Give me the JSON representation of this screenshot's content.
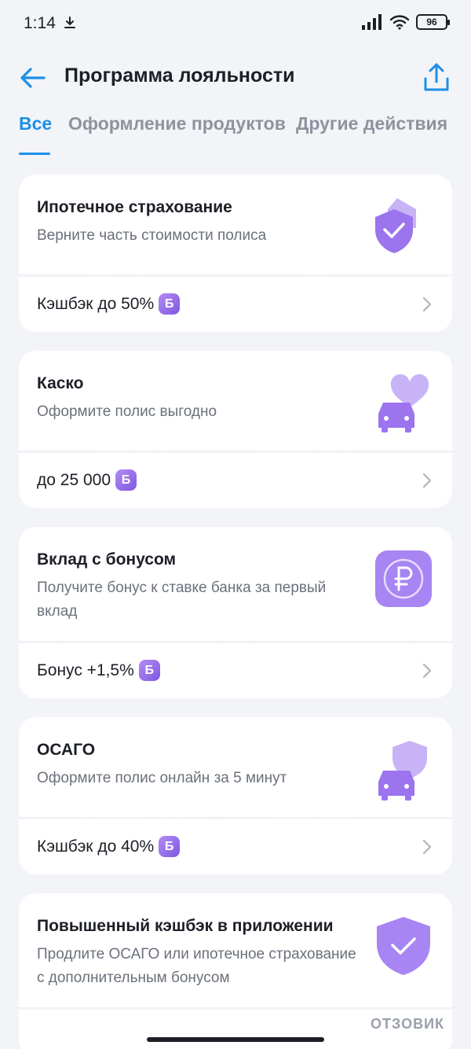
{
  "status": {
    "time": "1:14",
    "battery": "96"
  },
  "header": {
    "title": "Программа лояльности"
  },
  "tabs": [
    {
      "label": "Все"
    },
    {
      "label": "Оформление продуктов"
    },
    {
      "label": "Другие действия"
    }
  ],
  "cards": [
    {
      "title": "Ипотечное страхование",
      "desc": "Верните часть стоимости полиса",
      "bonus": "Кэшбэк до 50%",
      "badge": "Б",
      "icon": "shield-check-icon"
    },
    {
      "title": "Каско",
      "desc": "Оформите полис выгодно",
      "bonus": "до 25 000",
      "badge": "Б",
      "icon": "car-heart-icon"
    },
    {
      "title": "Вклад с бонусом",
      "desc": "Получите бонус к ставке банка за первый вклад",
      "bonus": "Бонус +1,5%",
      "badge": "Б",
      "icon": "ruble-coin-icon"
    },
    {
      "title": "ОСАГО",
      "desc": "Оформите полис онлайн за 5 минут",
      "bonus": "Кэшбэк до 40%",
      "badge": "Б",
      "icon": "car-shield-icon"
    },
    {
      "title": "Повышенный кэшбэк в приложении",
      "desc": "Продлите ОСАГО или ипотечное страхование с дополнительным бонусом",
      "icon": "shield-check-icon"
    }
  ],
  "watermark": "ОТЗОВИК",
  "colors": {
    "accent": "#1d8fe6",
    "badge": "#8e63e8",
    "background": "#f2f4f8"
  }
}
